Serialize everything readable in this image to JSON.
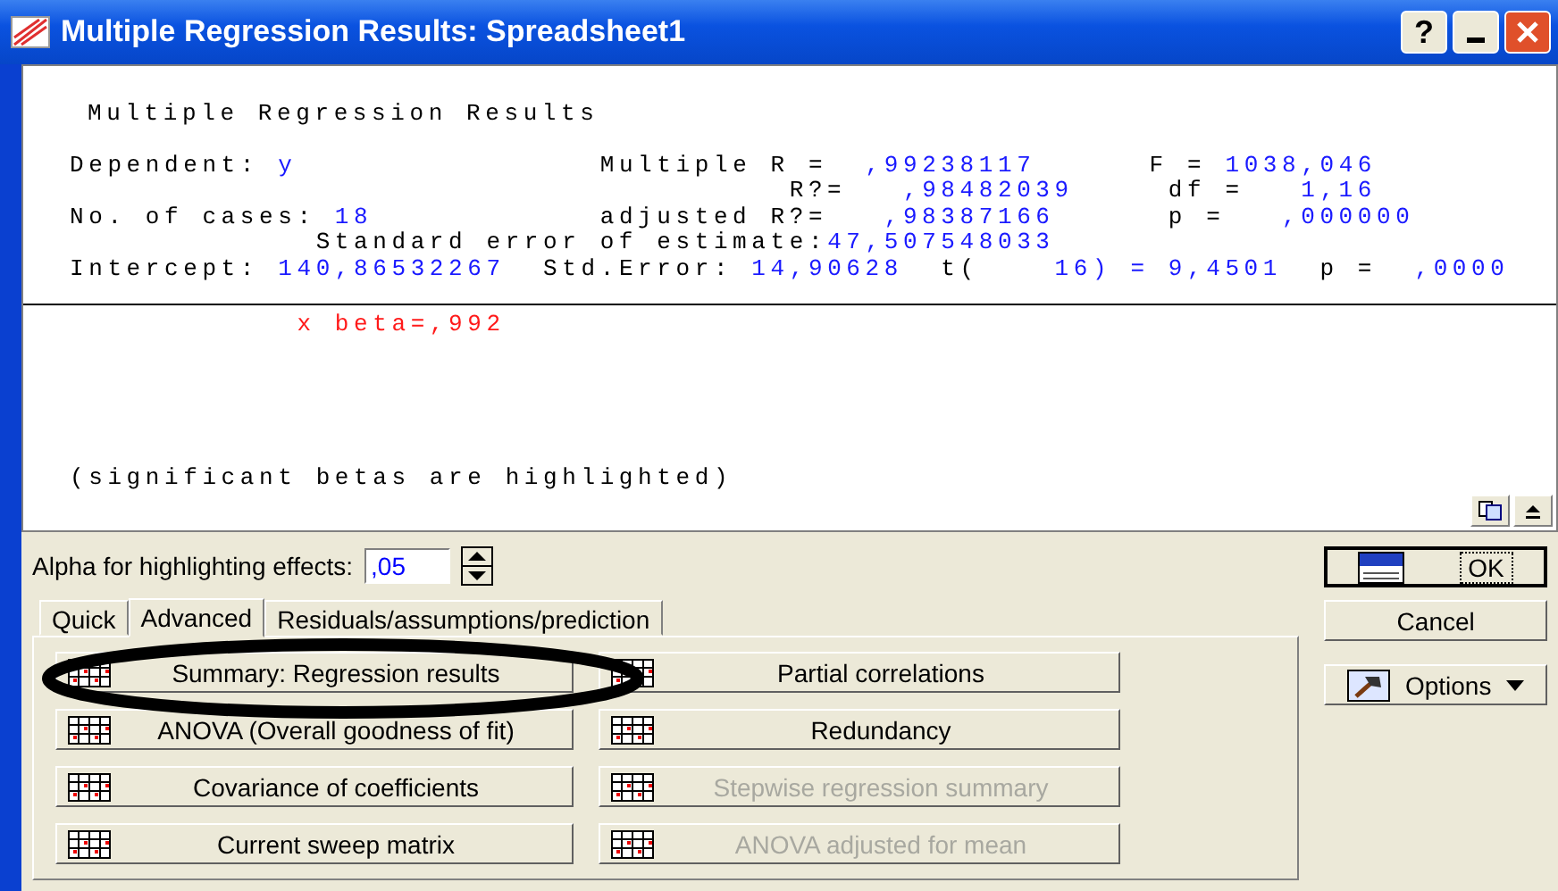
{
  "window": {
    "title": "Multiple Regression Results: Spreadsheet1",
    "controls": [
      {
        "kind": "help",
        "label": "?"
      },
      {
        "kind": "minimize"
      },
      {
        "kind": "close"
      }
    ]
  },
  "report": {
    "title": "Multiple Regression Results",
    "header_lines": [
      {
        "segments": [
          {
            "text": "Dependent: ",
            "kind": "label"
          },
          {
            "text": "y",
            "kind": "value"
          },
          {
            "text": "                Multiple R =  ",
            "kind": "label"
          },
          {
            "text": ",99238117",
            "kind": "value"
          },
          {
            "text": "      F = ",
            "kind": "label"
          },
          {
            "text": "1038,046",
            "kind": "value"
          }
        ]
      },
      {
        "segments": [
          {
            "text": "                                      R?=   ",
            "kind": "label"
          },
          {
            "text": ",98482039",
            "kind": "value"
          },
          {
            "text": "     df =   ",
            "kind": "label"
          },
          {
            "text": "1,16",
            "kind": "value"
          }
        ]
      },
      {
        "segments": [
          {
            "text": "No. of cases: ",
            "kind": "label"
          },
          {
            "text": "18",
            "kind": "value"
          },
          {
            "text": "            adjusted R?=   ",
            "kind": "label"
          },
          {
            "text": ",98387166",
            "kind": "value"
          },
          {
            "text": "      p =   ",
            "kind": "label"
          },
          {
            "text": ",000000",
            "kind": "value"
          }
        ]
      },
      {
        "segments": [
          {
            "text": "             Standard error of estimate:",
            "kind": "label"
          },
          {
            "text": "47,507548033",
            "kind": "value"
          }
        ]
      },
      {
        "segments": [
          {
            "text": "Intercept: ",
            "kind": "label"
          },
          {
            "text": "140,86532267",
            "kind": "value"
          },
          {
            "text": "  Std.Error: ",
            "kind": "label"
          },
          {
            "text": "14,90628",
            "kind": "value"
          },
          {
            "text": "  t(    ",
            "kind": "label"
          },
          {
            "text": "16) = 9,4501",
            "kind": "value"
          },
          {
            "text": "  p =  ",
            "kind": "label"
          },
          {
            "text": ",0000",
            "kind": "value"
          }
        ]
      }
    ],
    "beta_lines": [
      {
        "segments": [
          {
            "text": "            x beta=,992",
            "kind": "highlight"
          }
        ]
      }
    ],
    "footnote": "(significant betas are highlighted)",
    "tools": [
      {
        "kind": "copy"
      },
      {
        "kind": "collapse"
      }
    ]
  },
  "alpha": {
    "label": "Alpha for highlighting effects:",
    "value": ",05"
  },
  "tabs": [
    {
      "label": "Quick",
      "selected": false
    },
    {
      "label": "Advanced",
      "selected": true
    },
    {
      "label": "Residuals/assumptions/prediction",
      "selected": false
    }
  ],
  "buttons": [
    {
      "label": "Summary:  Regression results",
      "disabled": false
    },
    {
      "label": "Partial correlations",
      "disabled": false
    },
    {
      "label": "ANOVA (Overall goodness of fit)",
      "disabled": false
    },
    {
      "label": "Redundancy",
      "disabled": false
    },
    {
      "label": "Covariance of coefficients",
      "disabled": false
    },
    {
      "label": "Stepwise regression summary",
      "disabled": true
    },
    {
      "label": "Current sweep matrix",
      "disabled": false
    },
    {
      "label": "ANOVA adjusted for mean",
      "disabled": true
    }
  ],
  "side_buttons": [
    {
      "kind": "ok",
      "label": "OK"
    },
    {
      "kind": "cancel",
      "label": "Cancel"
    },
    {
      "kind": "options",
      "label": "Options"
    }
  ]
}
